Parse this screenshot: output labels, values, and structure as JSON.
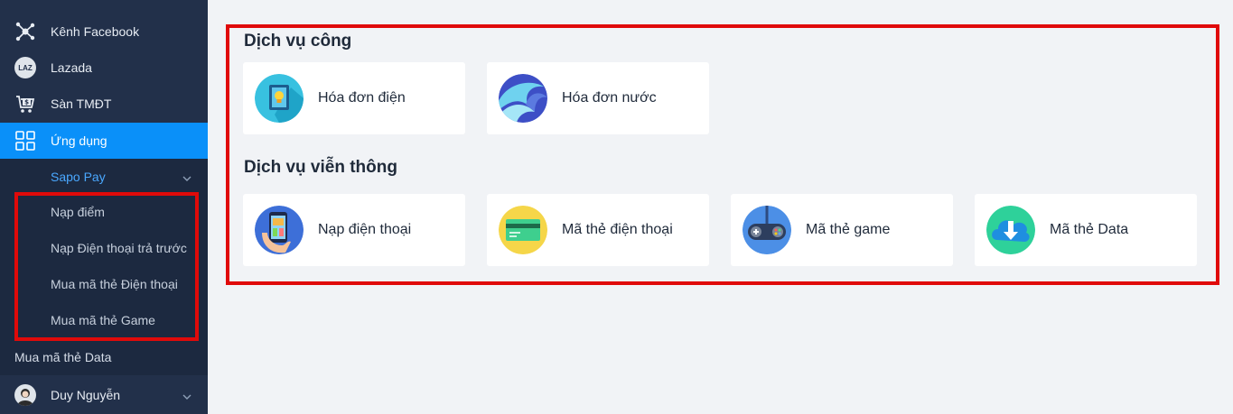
{
  "sidebar": {
    "items": [
      {
        "label": "Kênh Facebook",
        "icon": "facebook-channel-icon"
      },
      {
        "label": "Lazada",
        "icon": "lazada-icon",
        "badge": "LAZ"
      },
      {
        "label": "Sàn TMĐT",
        "icon": "cart-icon"
      },
      {
        "label": "Ứng dụng",
        "icon": "apps-grid-icon",
        "active": true
      }
    ],
    "sapo_pay": "Sapo Pay",
    "sub_items": [
      "Nạp điểm",
      "Nạp Điện thoại trả trước",
      "Mua mã thẻ Điện thoại",
      "Mua mã thẻ Game"
    ],
    "loose_item": "Mua mã thẻ Data",
    "user_name": "Duy Nguyễn",
    "colors": {
      "bg": "#22304a",
      "active": "#0a90f9",
      "highlight": "#e00a0a"
    }
  },
  "main": {
    "sections": [
      {
        "title": "Dịch vụ công",
        "cards": [
          {
            "label": "Hóa đơn điện",
            "icon": "electric-bill-icon"
          },
          {
            "label": "Hóa đơn nước",
            "icon": "water-bill-icon"
          }
        ]
      },
      {
        "title": "Dịch vụ viễn thông",
        "cards": [
          {
            "label": "Nạp điện thoại",
            "icon": "phone-topup-icon"
          },
          {
            "label": "Mã thẻ điện thoại",
            "icon": "phone-card-icon"
          },
          {
            "label": "Mã thẻ game",
            "icon": "gamepad-icon"
          },
          {
            "label": "Mã thẻ Data",
            "icon": "data-download-icon"
          }
        ]
      }
    ]
  }
}
